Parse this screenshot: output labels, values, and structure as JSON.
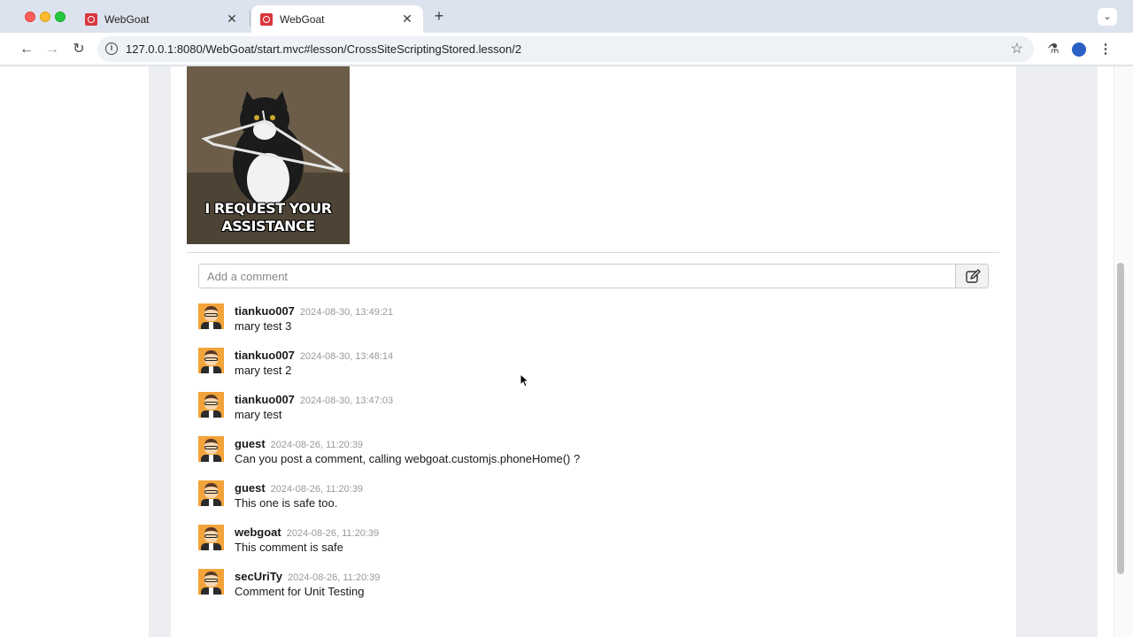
{
  "tabs": [
    {
      "title": "WebGoat",
      "close": "✕"
    },
    {
      "title": "WebGoat",
      "close": "✕"
    }
  ],
  "toolbar": {
    "new_tab": "+",
    "tab_search": "⌄",
    "back": "←",
    "forward": "→",
    "reload": "↻",
    "url": "127.0.0.1:8080/WebGoat/start.mvc#lesson/CrossSiteScriptingStored.lesson/2",
    "bookmark": "☆",
    "labs": "⚗",
    "menu": "⋮"
  },
  "meme": {
    "caption_line1": "I REQUEST YOUR",
    "caption_line2": "ASSISTANCE"
  },
  "comment_form": {
    "placeholder": "Add a comment"
  },
  "comments": [
    {
      "user": "tiankuo007",
      "time": "2024-08-30, 13:49:21",
      "text": "mary test 3"
    },
    {
      "user": "tiankuo007",
      "time": "2024-08-30, 13:48:14",
      "text": "mary test 2"
    },
    {
      "user": "tiankuo007",
      "time": "2024-08-30, 13:47:03",
      "text": "mary test"
    },
    {
      "user": "guest",
      "time": "2024-08-26, 11:20:39",
      "text": "Can you post a comment, calling webgoat.customjs.phoneHome() ?"
    },
    {
      "user": "guest",
      "time": "2024-08-26, 11:20:39",
      "text": "This one is safe too."
    },
    {
      "user": "webgoat",
      "time": "2024-08-26, 11:20:39",
      "text": "This comment is safe"
    },
    {
      "user": "secUriTy",
      "time": "2024-08-26, 11:20:39",
      "text": "Comment for Unit Testing"
    }
  ],
  "colors": {
    "favicon": "#d9363e",
    "avatar_bg": "#f2a33a",
    "page_bg": "#eceef2"
  }
}
